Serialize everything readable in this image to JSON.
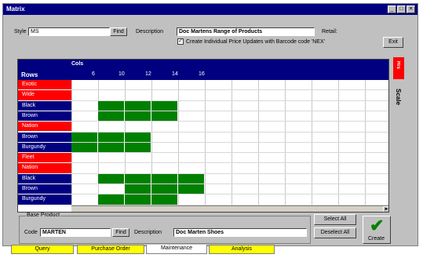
{
  "window": {
    "title": "Matrix",
    "buttons": [
      "_",
      "□",
      "✕"
    ]
  },
  "style_field": {
    "label": "Style",
    "value": "MS"
  },
  "find_button": "Find",
  "description_field": {
    "label": "Description",
    "value": "Doc Martens Range of Products"
  },
  "retail_label": "Retail:",
  "price_update_checkbox": {
    "checked": true,
    "mark": "✓",
    "label": "Create Individual Price Updates with Barcode code 'NEX'"
  },
  "exit_button": "Exit",
  "matrix": {
    "cols_label": "Cols",
    "rows_label": "Rows",
    "columns": [
      "6",
      "10",
      "12",
      "14",
      "16"
    ],
    "rows": [
      {
        "label": "Exotic",
        "kind": "header"
      },
      {
        "label": "Wide",
        "kind": "header"
      },
      {
        "label": "Black",
        "kind": "item"
      },
      {
        "label": "Brown",
        "kind": "item"
      },
      {
        "label": "Nation",
        "kind": "header"
      },
      {
        "label": "Brown",
        "kind": "item"
      },
      {
        "label": "Burgundy",
        "kind": "item"
      },
      {
        "label": "Fleet",
        "kind": "header"
      },
      {
        "label": "Nation",
        "kind": "header"
      },
      {
        "label": "Black",
        "kind": "item"
      },
      {
        "label": "Brown",
        "kind": "item"
      },
      {
        "label": "Burgundy",
        "kind": "item"
      }
    ],
    "active_cells": [
      {
        "row": 2,
        "cols": [
          1,
          2,
          3
        ]
      },
      {
        "row": 3,
        "cols": [
          1,
          2,
          3
        ]
      },
      {
        "row": 5,
        "cols": [
          0,
          1,
          2
        ]
      },
      {
        "row": 6,
        "cols": [
          0,
          1,
          2
        ]
      },
      {
        "row": 9,
        "cols": [
          1,
          2,
          3,
          4
        ]
      },
      {
        "row": 10,
        "cols": [
          2,
          3,
          4
        ]
      },
      {
        "row": 11,
        "cols": [
          1,
          2,
          3
        ]
      }
    ],
    "scroll_right": "►"
  },
  "side_tab": {
    "red_label": "Hrs",
    "label": "Scale"
  },
  "base_product": {
    "legend": "Base Product",
    "code_label": "Code",
    "code_value": "MARTEN",
    "find_button": "Find",
    "description_label": "Description",
    "description_value": "Doc Marten Shoes"
  },
  "select_all_button": "Select All",
  "deselect_all_button": "Deselect All",
  "create_button": {
    "label": "Create",
    "icon": "✔"
  },
  "bottom_tabs": [
    "Query",
    "Purchase Order",
    "Maintenance",
    "Analysis"
  ],
  "colors": {
    "header_red": "#ff0000",
    "navy": "#000080",
    "active_cell": "#008000",
    "tab_yellow": "#ffff00"
  }
}
